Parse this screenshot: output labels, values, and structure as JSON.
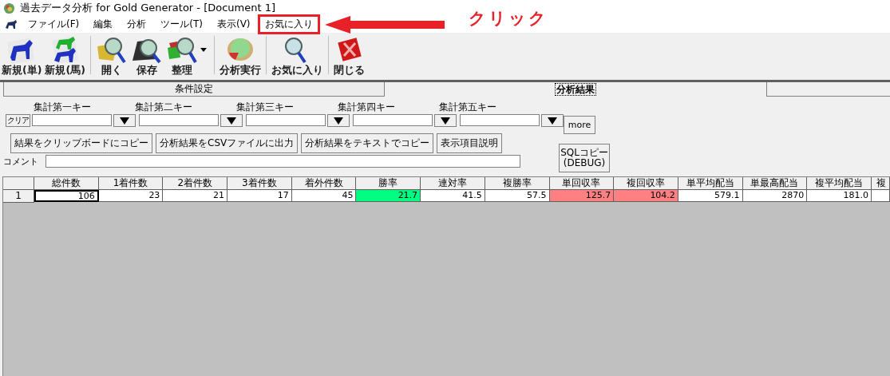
{
  "window": {
    "title": "過去データ分析 for Gold Generator - [Document 1]"
  },
  "menu": [
    {
      "label": "ファイル(F)",
      "highlighted": false
    },
    {
      "label": "編集",
      "highlighted": false
    },
    {
      "label": "分析",
      "highlighted": false
    },
    {
      "label": "ツール(T)",
      "highlighted": false
    },
    {
      "label": "表示(V)",
      "highlighted": false
    },
    {
      "label": "お気に入り",
      "highlighted": true
    }
  ],
  "annotation": {
    "text": "クリック"
  },
  "toolbar": [
    {
      "kind": "horse",
      "label": "新規(単)"
    },
    {
      "kind": "horses",
      "label": "新規(馬)"
    },
    {
      "kind": "separator"
    },
    {
      "kind": "open",
      "label": "開く"
    },
    {
      "kind": "save",
      "label": "保存"
    },
    {
      "kind": "organize",
      "label": "整理",
      "has_menu": true
    },
    {
      "kind": "separator"
    },
    {
      "kind": "analyze",
      "label": "分析実行"
    },
    {
      "kind": "separator"
    },
    {
      "kind": "favorite",
      "label": "お気に入り"
    },
    {
      "kind": "separator"
    },
    {
      "kind": "close",
      "label": "閉じる"
    }
  ],
  "tabs": [
    {
      "label": "条件設定",
      "selected": false
    },
    {
      "label": "分析結果",
      "selected": true
    }
  ],
  "clear_button": "クリア",
  "keys": [
    {
      "label": "集計第一キー"
    },
    {
      "label": "集計第二キー"
    },
    {
      "label": "集計第三キー"
    },
    {
      "label": "集計第四キー"
    },
    {
      "label": "集計第五キー"
    }
  ],
  "more_button": "more",
  "actions": [
    "結果をクリップボードにコピー",
    "分析結果をCSVファイルに出力",
    "分析結果をテキストでコピー",
    "表示項目説明"
  ],
  "sql_button": "SQLコピー\n(DEBUG)",
  "comment": {
    "label": "コメント"
  },
  "table": {
    "columns": [
      "総件数",
      "1着件数",
      "2着件数",
      "3着件数",
      "着外件数",
      "勝率",
      "連対率",
      "複勝率",
      "単回収率",
      "複回収率",
      "単平均配当",
      "単最高配当",
      "複平均配当",
      "複"
    ],
    "rows": [
      {
        "header": "1",
        "cells": [
          {
            "text": "106",
            "focused": true
          },
          {
            "text": "23"
          },
          {
            "text": "21"
          },
          {
            "text": "17"
          },
          {
            "text": "45"
          },
          {
            "text": "21.7",
            "color": "#00ff80"
          },
          {
            "text": "41.5"
          },
          {
            "text": "57.5"
          },
          {
            "text": "125.7",
            "color": "#ff8080"
          },
          {
            "text": "104.2",
            "color": "#ff8080"
          },
          {
            "text": "579.1"
          },
          {
            "text": "2870"
          },
          {
            "text": "181.0"
          },
          {
            "text": ""
          }
        ]
      }
    ]
  }
}
